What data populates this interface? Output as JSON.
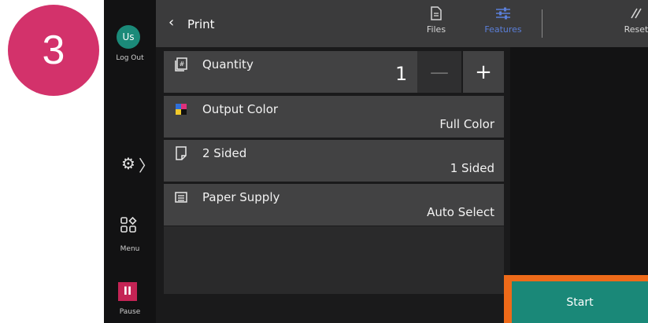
{
  "step_badge": "3",
  "rail": {
    "avatar": "Us",
    "logout_label": "Log Out",
    "settings_icon": "gear-icon",
    "chevron": "〉",
    "menu_label": "Menu",
    "pause_icon": "II",
    "pause_label": "Pause"
  },
  "header": {
    "back_icon": "‹",
    "title": "Print",
    "files_label": "Files",
    "features_label": "Features",
    "reset_label": "Reset"
  },
  "settings": [
    {
      "name": "Quantity",
      "value": "1",
      "icon": "quantity-icon"
    },
    {
      "name": "Output Color",
      "value": "Full Color",
      "icon": "color-icon"
    },
    {
      "name": "2 Sided",
      "value": "1 Sided",
      "icon": "page-icon"
    },
    {
      "name": "Paper Supply",
      "value": "Auto Select",
      "icon": "paper-tray-icon"
    }
  ],
  "stepper": {
    "minus": "—",
    "plus": "+"
  },
  "start_label": "Start",
  "colors": {
    "badge": "#d3326b",
    "accent_teal": "#1a8878",
    "highlight_orange": "#ee6a19",
    "features_active": "#5b7fd9"
  }
}
